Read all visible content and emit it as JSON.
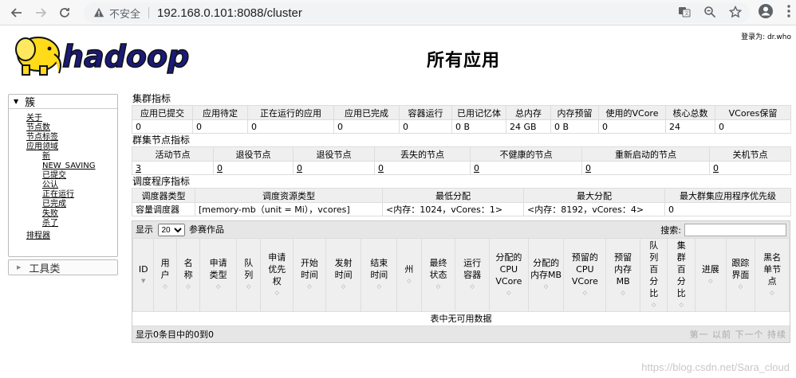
{
  "browser": {
    "insecure_label": "不安全",
    "url": "192.168.0.101:8088/cluster"
  },
  "header": {
    "logo_text": "hadoop",
    "logged_in": "登录为: dr.who",
    "page_title": "所有应用"
  },
  "sidebar": {
    "cluster_label": "簇",
    "links": [
      "关于",
      "节点数",
      "节点标签",
      "应用领域"
    ],
    "app_states": [
      "新",
      "NEW_SAVING",
      "已提交",
      "公认",
      "正在运行",
      "已完成",
      "失败",
      "杀了"
    ],
    "scheduler": "排程器",
    "tools_label": "工具类"
  },
  "cluster_metrics": {
    "title": "集群指标",
    "headers": [
      "应用已提交",
      "应用待定",
      "正在运行的应用",
      "应用已完成",
      "容器运行",
      "已用记忆体",
      "总内存",
      "内存预留",
      "使用的VCore",
      "核心总数",
      "VCores保留"
    ],
    "values": [
      "0",
      "0",
      "0",
      "0",
      "0",
      "0 B",
      "24 GB",
      "0 B",
      "0",
      "24",
      "0"
    ]
  },
  "node_metrics": {
    "title": "群集节点指标",
    "headers": [
      "活动节点",
      "退役节点",
      "退役节点",
      "丢失的节点",
      "不健康的节点",
      "重新启动的节点",
      "关机节点"
    ],
    "values": [
      "3",
      "0",
      "0",
      "0",
      "0",
      "0",
      "0"
    ]
  },
  "scheduler_metrics": {
    "title": "调度程序指标",
    "headers": [
      "调度器类型",
      "调度资源类型",
      "最低分配",
      "最大分配",
      "最大群集应用程序优先级"
    ],
    "values": [
      "容量调度器",
      "[memory-mb（unit = Mi），vcores]",
      "<内存：1024，vCores：1>",
      "<内存：8192，vCores：4>",
      "0"
    ]
  },
  "apps_table": {
    "show_label": "显示",
    "page_size": "20",
    "entries_label": "参赛作品",
    "search_label": "搜索:",
    "columns": [
      "ID",
      "用户",
      "名称",
      "申请类型",
      "队列",
      "申请优先权",
      "开始时间",
      "发射时间",
      "结束时间",
      "州",
      "最终状态",
      "运行容器",
      "分配的CPU VCore",
      "分配的内存MB",
      "预留的CPU VCore",
      "预留内存MB",
      "队列百分比",
      "集群百分比",
      "进展",
      "跟踪界面",
      "黑名单节点"
    ],
    "empty_message": "表中无可用数据",
    "footer_info": "显示0条目中的0到0",
    "pager": [
      "第一",
      "以前",
      "下一个",
      "持续"
    ]
  },
  "watermark": "https://blog.csdn.net/Sara_cloud"
}
